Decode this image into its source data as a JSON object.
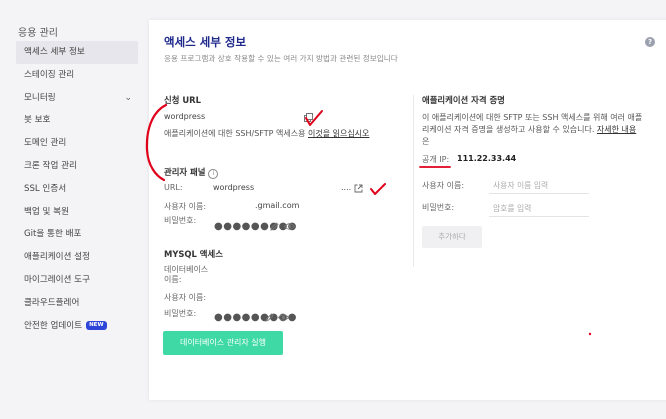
{
  "sidebar": {
    "heading": "응용 관리",
    "items": [
      {
        "label": "액세스 세부 정보"
      },
      {
        "label": "스테이징 관리"
      },
      {
        "label": "모니터링"
      },
      {
        "label": "봇 보호"
      },
      {
        "label": "도메인 관리"
      },
      {
        "label": "크론 작업 관리"
      },
      {
        "label": "SSL 인증서"
      },
      {
        "label": "백업 및 복원"
      },
      {
        "label": "Git을 통한 배포"
      },
      {
        "label": "애플리케이션 설정"
      },
      {
        "label": "마이그레이션 도구"
      },
      {
        "label": "클라우드플레어"
      },
      {
        "label": "안전한 업데이트"
      }
    ],
    "new_badge": "NEW"
  },
  "card": {
    "title": "액세스 세부 정보",
    "subtitle": "응용 프로그램과 상호 작용할 수 있는 여러 가지 방법과 관련된 정보입니다"
  },
  "app_url": {
    "heading": "신청 URL",
    "url": "wordpress",
    "note": "애플리케이션에 대한 SSH/SFTP 액세스용",
    "note_link": "이것을 읽으십시오"
  },
  "admin_panel": {
    "heading": "관리자 패널",
    "url_label": "URL:",
    "url_value": "wordpress",
    "url_suffix": "....",
    "username_label": "사용자 이름:",
    "username_value": ".gmail.com",
    "password_label": "비밀번호:",
    "password_mask": "●●●●●●●●●"
  },
  "mysql": {
    "heading": "MYSQL 액세스",
    "db_label": "데이터베이스 이름:",
    "username_label": "사용자 이름:",
    "password_label": "비밀번호:",
    "password_mask": "●●●●●●●●●",
    "button": "데이터베이스 관리자 실행"
  },
  "credentials": {
    "heading": "애플리케이션 자격 증명",
    "desc_1": "이 애플리케이션에 대한 SFTP 또는 SSH 액세스를 위해 여러 애플",
    "desc_2": "리케이션 자격 증명을 생성하고 사용할 수 있습니다.",
    "desc_link": "자세한 내용",
    "desc_3": "은",
    "public_ip_label": "공개 IP:",
    "public_ip_value": "111.22.33.44",
    "username_label": "사용자 이름:",
    "username_placeholder": "사용자 이름 입력",
    "password_label": "비밀번호:",
    "password_placeholder": "암호를 입력",
    "add_button": "추가하다"
  },
  "icons": {
    "help": "question-circle-icon",
    "copy": "copy-icon",
    "external": "external-link-icon",
    "info": "info-icon",
    "edit": "pencil-icon",
    "view": "eye-icon",
    "chevron": "chevron-down-icon"
  },
  "colors": {
    "title_blue": "#1f2a8c",
    "button_green": "#3ed9a4",
    "badge_blue": "#2d45d8",
    "annotation_red": "#e0001a"
  }
}
